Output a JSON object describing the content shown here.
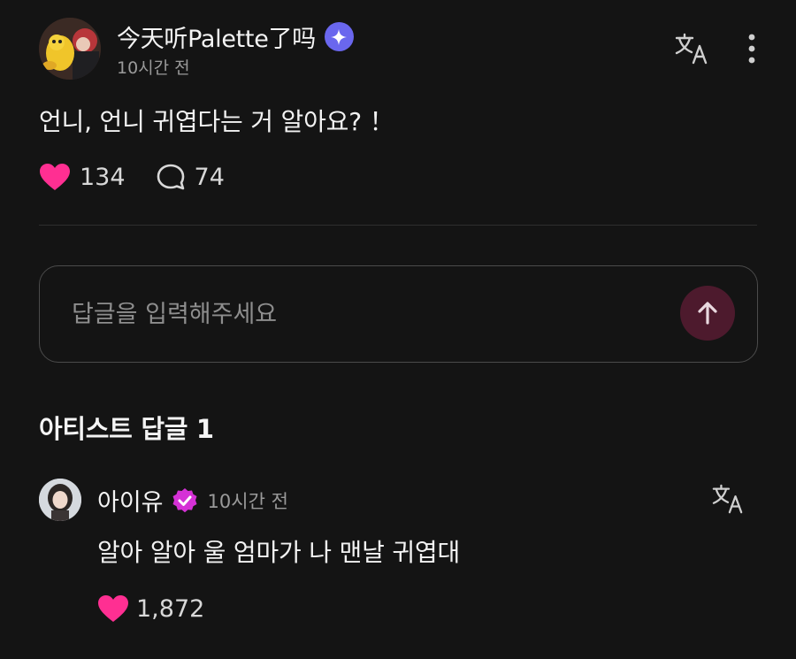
{
  "post": {
    "author": "今天听Palette了吗",
    "time": "10시간 전",
    "body": "언니, 언니 귀엽다는 거 알아요? ！",
    "likes": "134",
    "comments": "74",
    "badge_icon": "sparkle-badge-icon"
  },
  "reply_input": {
    "placeholder": "답글을 입력해주세요"
  },
  "artist_section": {
    "title": "아티스트 답글",
    "count": "1"
  },
  "artist_reply": {
    "name": "아이유",
    "time": "10시간 전",
    "body": "알아 알아 울 엄마가 나 맨날 귀엽대",
    "likes": "1,872"
  },
  "colors": {
    "background": "#141414",
    "heart": "#ff2f92",
    "badge_blue": "#6a67ee",
    "verified_pink": "#d531d6",
    "send_button": "#4d1a2d"
  }
}
